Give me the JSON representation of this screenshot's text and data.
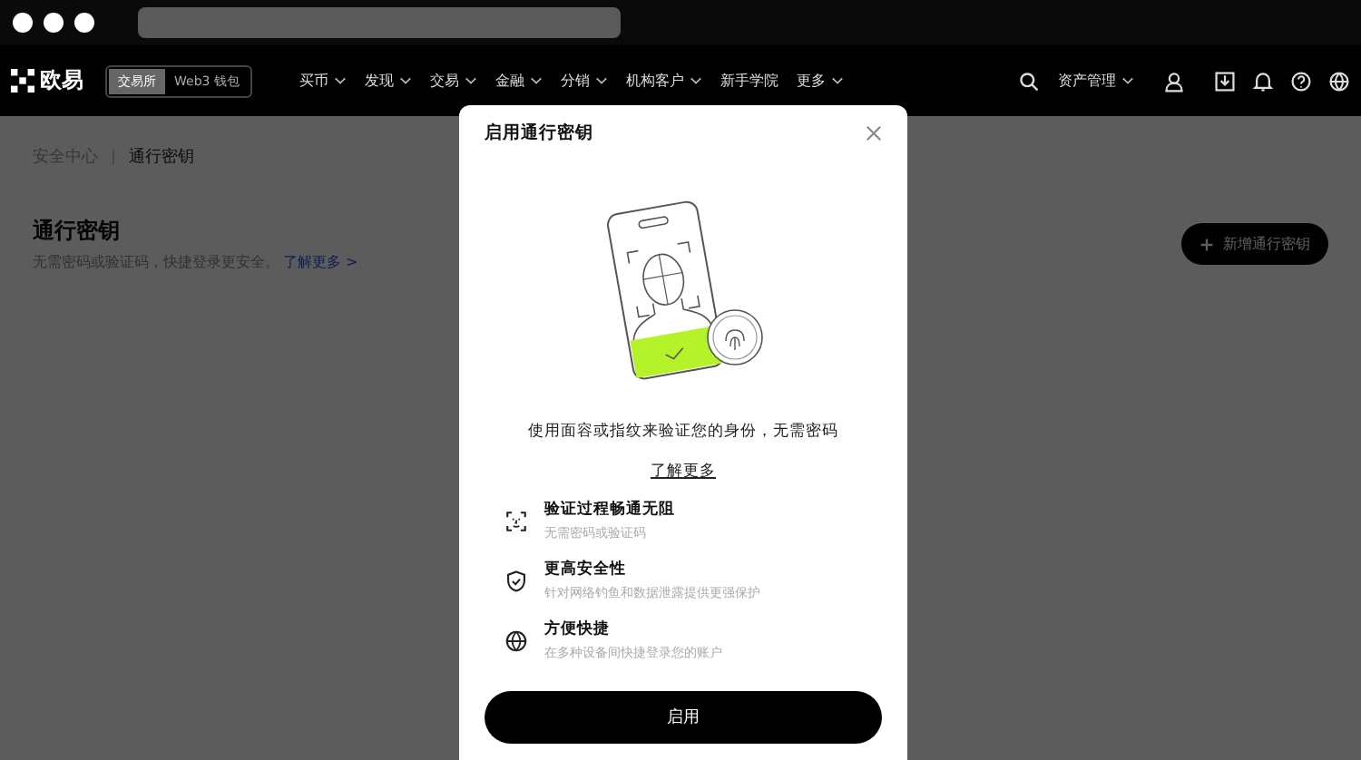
{
  "nav": {
    "logo": "欧易",
    "modes": [
      {
        "label": "交易所",
        "selected": true
      },
      {
        "label": "Web3 钱包",
        "selected": false
      }
    ],
    "items": [
      {
        "label": "买币",
        "has_menu": true
      },
      {
        "label": "发现",
        "has_menu": true
      },
      {
        "label": "交易",
        "has_menu": true
      },
      {
        "label": "金融",
        "has_menu": true
      },
      {
        "label": "分销",
        "has_menu": true
      },
      {
        "label": "机构客户",
        "has_menu": true
      },
      {
        "label": "新手学院",
        "has_menu": false
      },
      {
        "label": "更多",
        "has_menu": true
      }
    ],
    "assets": "资产管理"
  },
  "breadcrumb": [
    "安全中心",
    "通行密钥"
  ],
  "page": {
    "title": "通行密钥",
    "description": "无需密码或验证码，快捷登录更安全。",
    "link": "了解更多 >",
    "add_button": "新增通行密钥"
  },
  "modal": {
    "title": "启用通行密钥",
    "intro": "使用面容或指纹来验证您的身份，无需密码",
    "link": "了解更多",
    "features": [
      {
        "kind": "face",
        "title": "验证过程畅通无阻",
        "text": "无需密码或验证码"
      },
      {
        "kind": "shield",
        "title": "更高安全性",
        "text": "针对网络钓鱼和数据泄露提供更强保护"
      },
      {
        "kind": "globe",
        "title": "方便快捷",
        "text": "在多种设备间快捷登录您的账户"
      }
    ],
    "button": "启用"
  }
}
